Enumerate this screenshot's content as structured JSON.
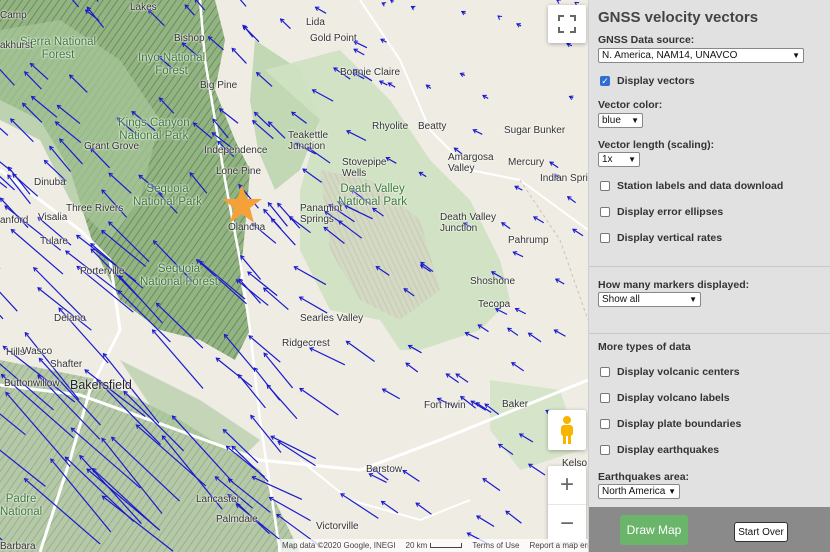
{
  "panel": {
    "title": "GNSS velocity vectors",
    "source_label": "GNSS Data source:",
    "source_value": "N. America, NAM14, UNAVCO",
    "display_vectors": "Display vectors",
    "color_label": "Vector color:",
    "color_value": "blue",
    "length_label": "Vector length (scaling):",
    "length_value": "1x",
    "station_labels": "Station labels and data download",
    "error_ellipses": "Display error ellipses",
    "vertical_rates": "Display vertical rates",
    "markers_label": "How many markers displayed:",
    "markers_value": "Show all",
    "more_types": "More types of data",
    "volcanic_centers": "Display volcanic centers",
    "volcano_labels": "Display volcano labels",
    "plate_boundaries": "Display plate boundaries",
    "earthquakes": "Display earthquakes",
    "eq_area_label": "Earthquakes area:",
    "eq_area_value": "North America",
    "draw_map": "Draw Map",
    "start_over": "Start Over"
  },
  "map": {
    "vector_color": "#1a1acc",
    "star_color": "#f5a13a",
    "attribution": {
      "data": "Map data ©2020 Google, INEGI",
      "scale": "20 km",
      "terms": "Terms of Use",
      "report": "Report a map error"
    },
    "zoom_in": "+",
    "zoom_out": "−",
    "labels": [
      {
        "t": "Camp",
        "c": "city"
      },
      {
        "t": "Lakes",
        "c": "city"
      },
      {
        "t": "Lida",
        "c": "city"
      },
      {
        "t": "Sierra National\nForest",
        "c": "park"
      },
      {
        "t": "Bishop",
        "c": "city"
      },
      {
        "t": "Gold Point",
        "c": "city"
      },
      {
        "t": "akhurst",
        "c": "city"
      },
      {
        "t": "Inyo National\nForest",
        "c": "park"
      },
      {
        "t": "Bonnie Claire",
        "c": "city"
      },
      {
        "t": "Big Pine",
        "c": "city"
      },
      {
        "t": "Kings Canyon\nNational Park",
        "c": "park"
      },
      {
        "t": "Rhyolite",
        "c": "city"
      },
      {
        "t": "Beatty",
        "c": "city"
      },
      {
        "t": "Sugar Bunker",
        "c": "city"
      },
      {
        "t": "Teakettle\nJunction",
        "c": "city"
      },
      {
        "t": "Grant Grove",
        "c": "city"
      },
      {
        "t": "Independence",
        "c": "city"
      },
      {
        "t": "Amargosa\nValley",
        "c": "city"
      },
      {
        "t": "Mercury",
        "c": "city"
      },
      {
        "t": "Lone Pine",
        "c": "city"
      },
      {
        "t": "Stovepipe\nWells",
        "c": "city"
      },
      {
        "t": "Indian Springs",
        "c": "city"
      },
      {
        "t": "Dinuba",
        "c": "city"
      },
      {
        "t": "Sequoia\nNational Park",
        "c": "park"
      },
      {
        "t": "Death Valley\nNational Park",
        "c": "park"
      },
      {
        "t": "Three Rivers",
        "c": "city"
      },
      {
        "t": "Panamint\nSprings",
        "c": "city"
      },
      {
        "t": "Visalia",
        "c": "city"
      },
      {
        "t": "anford",
        "c": "city"
      },
      {
        "t": "Death Valley\nJunction",
        "c": "city"
      },
      {
        "t": "Olancha",
        "c": "city"
      },
      {
        "t": "Pahrump",
        "c": "city"
      },
      {
        "t": "Tulare",
        "c": "city"
      },
      {
        "t": "Porterville",
        "c": "city"
      },
      {
        "t": "Shoshone",
        "c": "city"
      },
      {
        "t": "Sequoia\nNational Forest",
        "c": "park"
      },
      {
        "t": "Tecopa",
        "c": "city"
      },
      {
        "t": "Delano",
        "c": "city"
      },
      {
        "t": "Searles Valley",
        "c": "city"
      },
      {
        "t": "Ridgecrest",
        "c": "city"
      },
      {
        "t": "Hills",
        "c": "city"
      },
      {
        "t": "Wasco",
        "c": "city"
      },
      {
        "t": "Shafter",
        "c": "city"
      },
      {
        "t": "Buttonwillow",
        "c": "city"
      },
      {
        "t": "Bakersfield",
        "c": "big"
      },
      {
        "t": "Fort Irwin",
        "c": "city"
      },
      {
        "t": "Baker",
        "c": "city"
      },
      {
        "t": "Barstow",
        "c": "city"
      },
      {
        "t": "Kelso",
        "c": "city"
      },
      {
        "t": "Padre\nNational",
        "c": "park"
      },
      {
        "t": "Lancaster",
        "c": "city"
      },
      {
        "t": "Palmdale",
        "c": "city"
      },
      {
        "t": "Victorville",
        "c": "city"
      },
      {
        "t": "Barbara",
        "c": "city"
      }
    ]
  }
}
